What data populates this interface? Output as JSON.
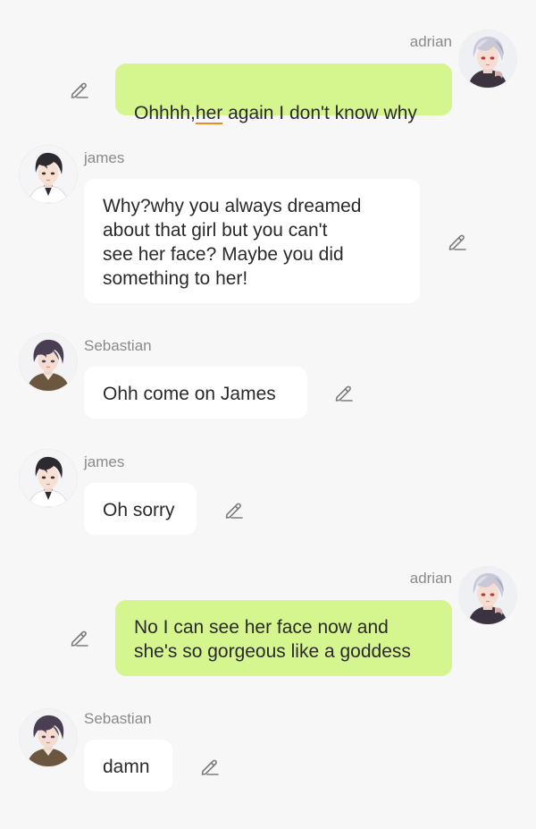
{
  "colors": {
    "background": "#f7f7f7",
    "incoming_bubble": "#ffffff",
    "outgoing_bubble": "#d5f58f",
    "name_text": "#8a8a8a",
    "spellcheck_underline": "#ef8a1c"
  },
  "messages": [
    {
      "sender": "adrian",
      "direction": "outgoing",
      "text_before": "Ohhhh,",
      "text_flagged": "her",
      "text_after": " again I don't know why",
      "avatar_icon": "character-avatar-adrian-icon",
      "action_icon": "edit-pencil-icon"
    },
    {
      "sender": "james",
      "direction": "incoming",
      "text": "Why?why you always dreamed\nabout that girl but you can't\nsee her face? Maybe you did\nsomething to her!",
      "avatar_icon": "character-avatar-james-icon",
      "action_icon": "edit-pencil-icon"
    },
    {
      "sender": "Sebastian",
      "direction": "incoming",
      "text": "Ohh come on James",
      "avatar_icon": "character-avatar-sebastian-icon",
      "action_icon": "edit-pencil-icon"
    },
    {
      "sender": "james",
      "direction": "incoming",
      "text": "Oh sorry",
      "avatar_icon": "character-avatar-james-icon",
      "action_icon": "edit-pencil-icon"
    },
    {
      "sender": "adrian",
      "direction": "outgoing",
      "text": "No I can see her face now and\nshe's so gorgeous like a goddess",
      "avatar_icon": "character-avatar-adrian-icon",
      "action_icon": "edit-pencil-icon"
    },
    {
      "sender": "Sebastian",
      "direction": "incoming",
      "text": "damn",
      "avatar_icon": "character-avatar-sebastian-icon",
      "action_icon": "edit-pencil-icon"
    }
  ]
}
